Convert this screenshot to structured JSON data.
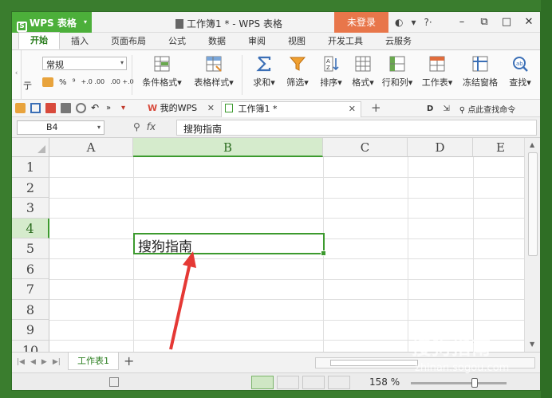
{
  "app": {
    "name": "WPS 表格",
    "doc_title": "工作簿1 * - WPS 表格",
    "login_label": "未登录"
  },
  "menu": {
    "tabs": [
      "开始",
      "插入",
      "页面布局",
      "公式",
      "数据",
      "审阅",
      "视图",
      "开发工具",
      "云服务"
    ]
  },
  "ribbon": {
    "number_format": "常规",
    "left_label": "亍",
    "fmt_percent": "%",
    "fmt_comma": "⁹",
    "dec_inc": "+.0 .00",
    "dec_dec": ".00 +.0",
    "cond_format": "条件格式",
    "table_style": "表格样式",
    "sum": "求和",
    "filter": "筛选",
    "sort": "排序",
    "format": "格式",
    "rowcol": "行和列",
    "worksheet": "工作表",
    "freeze": "冻结窗格",
    "find": "查找"
  },
  "tabs_bar": {
    "tab1": "我的WPS",
    "tab2": "工作簿1 *",
    "search": "点此查找命令"
  },
  "formula_bar": {
    "cell_ref": "B4",
    "fx": "fx",
    "value": "搜狗指南"
  },
  "grid": {
    "columns": [
      "A",
      "B",
      "C",
      "D",
      "E"
    ],
    "rows": [
      "1",
      "2",
      "3",
      "4",
      "5",
      "6",
      "7",
      "8",
      "9",
      "10"
    ],
    "active_cell_text": "搜狗指南"
  },
  "sheets": {
    "tabs": [
      "工作表1"
    ]
  },
  "status": {
    "zoom": "158 %"
  },
  "watermark": {
    "text": "搜狗指南",
    "url": "zhinan.sogou.com"
  },
  "colors": {
    "accent": "#3c9a2e",
    "app_green": "#4caf3a",
    "login_orange": "#e8764a",
    "arrow_red": "#e53935"
  }
}
